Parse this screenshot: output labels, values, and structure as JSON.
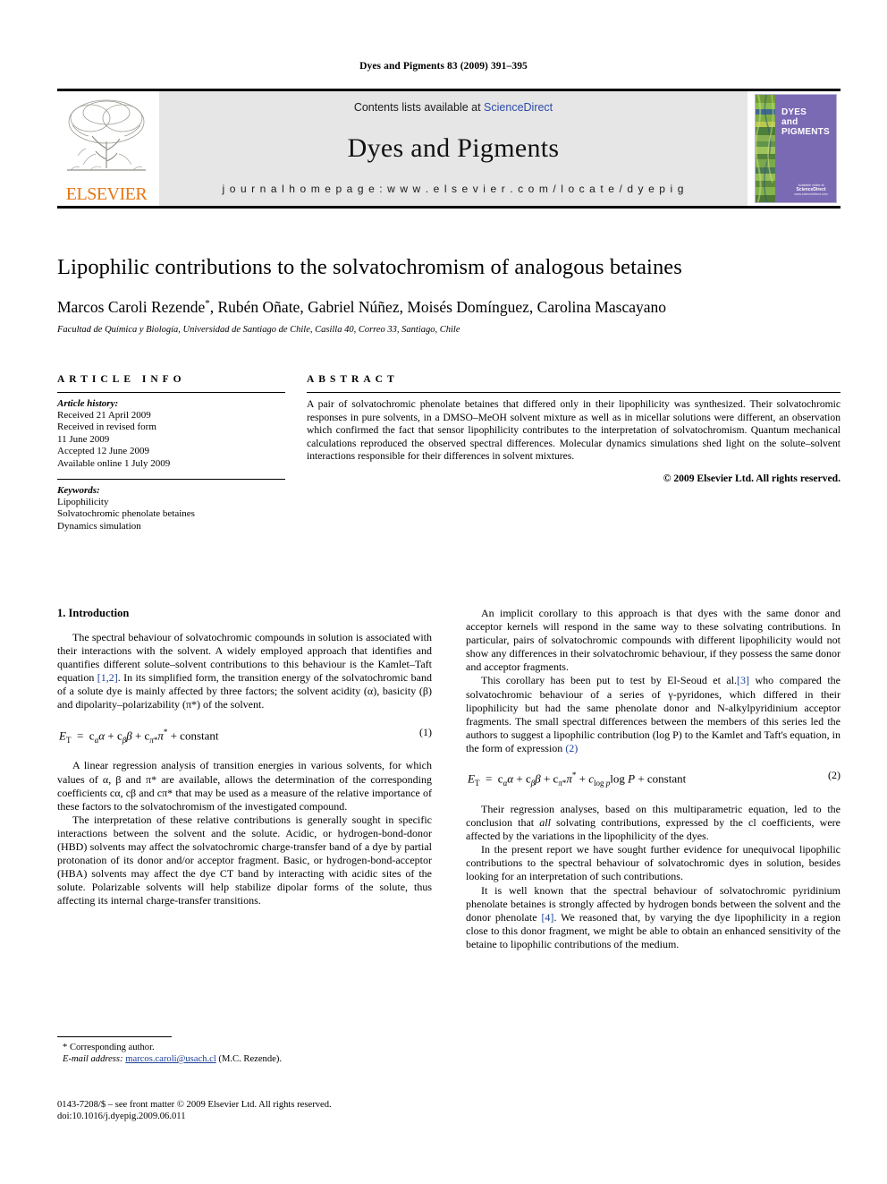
{
  "running_head": "Dyes and Pigments 83 (2009) 391–395",
  "masthead": {
    "publisher_wordmark": "ELSEVIER",
    "contents_prefix": "Contents lists available at ",
    "contents_link": "ScienceDirect",
    "journal_title": "Dyes and Pigments",
    "homepage": "j o u r n a l   h o m e p a g e :   w w w . e l s e v i e r . c o m / l o c a t e / d y e p i g",
    "cover_title_line1": "DYES",
    "cover_title_line2": "and",
    "cover_title_line3": "PIGMENTS",
    "cover_badge_top": "Available online at",
    "cover_badge": "ScienceDirect",
    "cover_badge_bottom": "www.sciencedirect.com",
    "colors": {
      "banner_bg": "#e6e6e6",
      "link_blue": "#2b4ba8",
      "elsevier_orange": "#E87511",
      "cover_purple": "#7a6ab4"
    }
  },
  "title": "Lipophilic contributions to the solvatochromism of analogous betaines",
  "authors": "Marcos Caroli Rezende, Rubén Oñate, Gabriel Núñez, Moisés Domínguez, Carolina Mascayano",
  "author_star": "*",
  "affiliation": "Facultad de Química y Biología, Universidad de Santiago de Chile, Casilla 40, Correo 33, Santiago, Chile",
  "article_info": {
    "heading": "ARTICLE INFO",
    "history_label": "Article history:",
    "history": [
      "Received 21 April 2009",
      "Received in revised form",
      "11 June 2009",
      "Accepted 12 June 2009",
      "Available online 1 July 2009"
    ],
    "keywords_label": "Keywords:",
    "keywords": [
      "Lipophilicity",
      "Solvatochromic phenolate betaines",
      "Dynamics simulation"
    ]
  },
  "abstract": {
    "heading": "ABSTRACT",
    "text": "A pair of solvatochromic phenolate betaines that differed only in their lipophilicity was synthesized. Their solvatochromic responses in pure solvents, in a DMSO–MeOH solvent mixture as well as in micellar solutions were different, an observation which confirmed the fact that sensor lipophilicity contributes to the interpretation of solvatochromism. Quantum mechanical calculations reproduced the observed spectral differences. Molecular dynamics simulations shed light on the solute–solvent interactions responsible for their differences in solvent mixtures.",
    "copyright": "© 2009 Elsevier Ltd. All rights reserved."
  },
  "body": {
    "section_number_title": "1. Introduction",
    "left_paragraphs": [
      {
        "id": "p1",
        "pre": "The spectral behaviour of solvatochromic compounds in solution is associated with their interactions with the solvent. A widely employed approach that identifies and quantifies different solute–solvent contributions to this behaviour is the Kamlet–Taft equation ",
        "cite": "[1,2]",
        "post": ". In its simplified form, the transition energy of the solvatochromic band of a solute dye is mainly affected by three factors; the solvent acidity (α), basicity (β) and dipolarity–polarizability (π*) of the solvent."
      },
      {
        "id": "p2",
        "pre": "A linear regression analysis of transition energies in various solvents, for which values of α, β and π* are available, allows the determination of the corresponding coefficients cα, cβ and cπ* that may be used as a measure of the relative importance of these factors to the solvatochromism of the investigated compound.",
        "cite": "",
        "post": ""
      },
      {
        "id": "p3",
        "pre": "The interpretation of these relative contributions is generally sought in specific interactions between the solvent and the solute. Acidic, or hydrogen-bond-donor (HBD) solvents may affect the solvatochromic charge-transfer band of a dye by partial protonation of its donor and/or acceptor fragment. Basic, or hydrogen-bond-acceptor (HBA) solvents may affect the dye CT band by interacting with acidic sites of the solute. Polarizable solvents will help stabilize dipolar forms of the solute, thus affecting its internal charge-transfer transitions.",
        "cite": "",
        "post": ""
      }
    ],
    "right_paragraphs": [
      {
        "id": "r1",
        "pre": "An implicit corollary to this approach is that dyes with the same donor and acceptor kernels will respond in the same way to these solvating contributions. In particular, pairs of solvatochromic compounds with different lipophilicity would not show any differences in their solvatochromic behaviour, if they possess the same donor and acceptor fragments.",
        "cite": "",
        "post": ""
      },
      {
        "id": "r2",
        "pre": "This corollary has been put to test by El-Seoud et al.",
        "cite": "[3]",
        "post": " who compared the solvatochromic behaviour of a series of γ-pyridones, which differed in their lipophilicity but had the same phenolate donor and N-alkylpyridinium acceptor fragments. The small spectral differences between the members of this series led the authors to suggest a lipophilic contribution (log P) to the Kamlet and Taft's equation, in the form of expression "
      },
      {
        "id": "r3",
        "pre": "Their regression analyses, based on this multiparametric equation, led to the conclusion that ",
        "cite": "",
        "post": " solvating contributions, expressed by the cl coefficients, were affected by the variations in the lipophilicity of the dyes."
      },
      {
        "id": "r4",
        "pre": "In the present report we have sought further evidence for unequivocal lipophilic contributions to the spectral behaviour of solvatochromic dyes in solution, besides looking for an interpretation of such contributions.",
        "cite": "",
        "post": ""
      },
      {
        "id": "r5",
        "pre": "It is well known that the spectral behaviour of solvatochromic pyridinium phenolate betaines is strongly affected by hydrogen bonds between the solvent and the donor phenolate ",
        "cite": "[4]",
        "post": ". We reasoned that, by varying the dye lipophilicity in a region close to this donor fragment, we might be able to obtain an enhanced sensitivity of the betaine to lipophilic contributions of the medium."
      }
    ],
    "inline_italic_all": "all",
    "inline_cite_2": "(2)",
    "equation1_number": "(1)",
    "equation2_number": "(2)"
  },
  "footnote": {
    "corresponding": "* Corresponding author.",
    "email_label": "E-mail address:",
    "email": "marcos.caroli@usach.cl",
    "email_suffix": "(M.C. Rezende)."
  },
  "imprint": {
    "line1": "0143-7208/$ – see front matter © 2009 Elsevier Ltd. All rights reserved.",
    "line2": "doi:10.1016/j.dyepig.2009.06.011"
  }
}
